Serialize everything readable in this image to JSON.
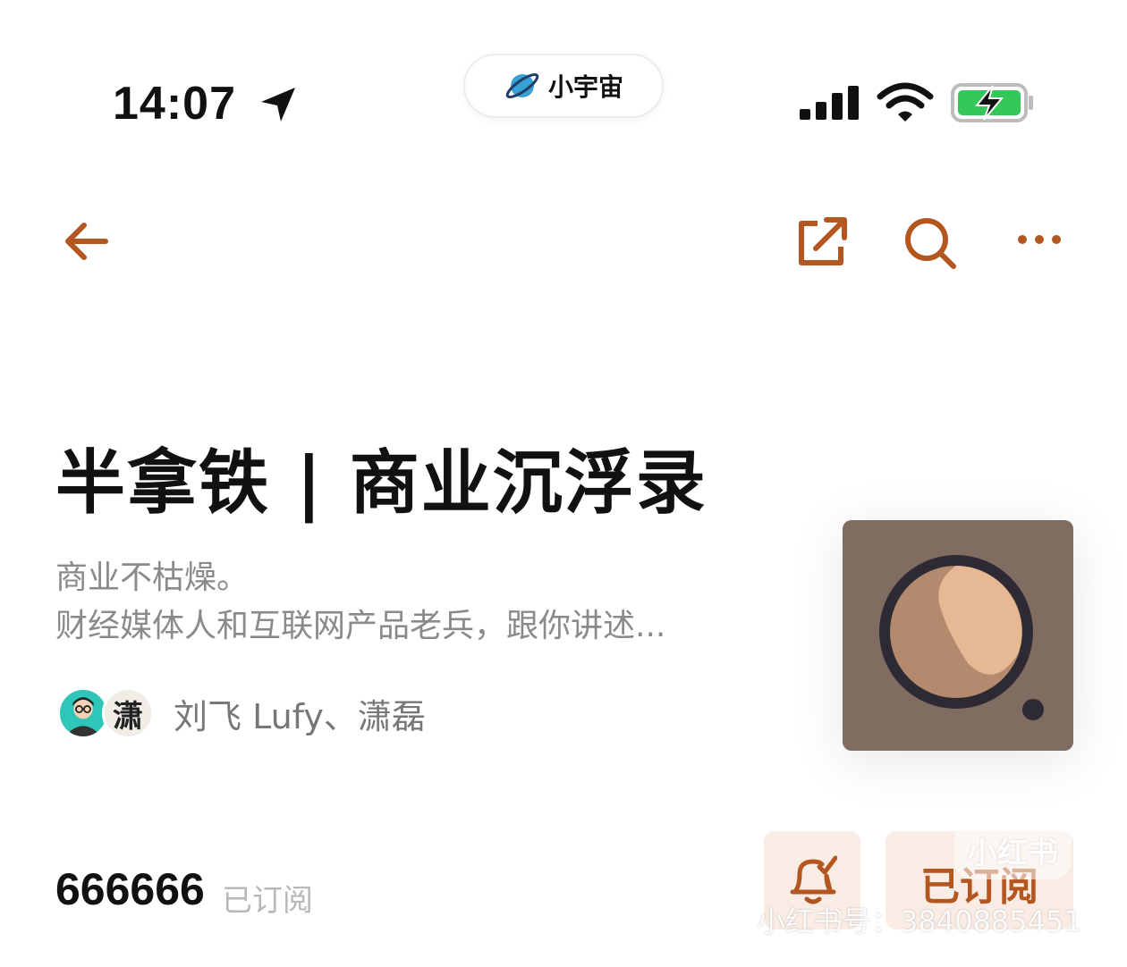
{
  "status_bar": {
    "time": "14:07",
    "island_label": "小宇宙"
  },
  "nav": {
    "icons": [
      "back-arrow-icon",
      "share-icon",
      "search-icon",
      "more-icon"
    ],
    "accent_color": "#b4561f"
  },
  "podcast": {
    "title": "半拿铁 | 商业沉浮录",
    "description_line1": "商业不枯燥。",
    "description_line2": "财经媒体人和互联网产品老兵，跟你讲述...",
    "authors": "刘飞 Lufy、潇磊",
    "avatar2_glyph": "潇",
    "subscriber_count": "666666",
    "subscribed_label": "已订阅",
    "subscribe_button": "已订阅"
  },
  "watermark": {
    "logo": "小红书",
    "id_text": "小红书号：3840885451"
  }
}
